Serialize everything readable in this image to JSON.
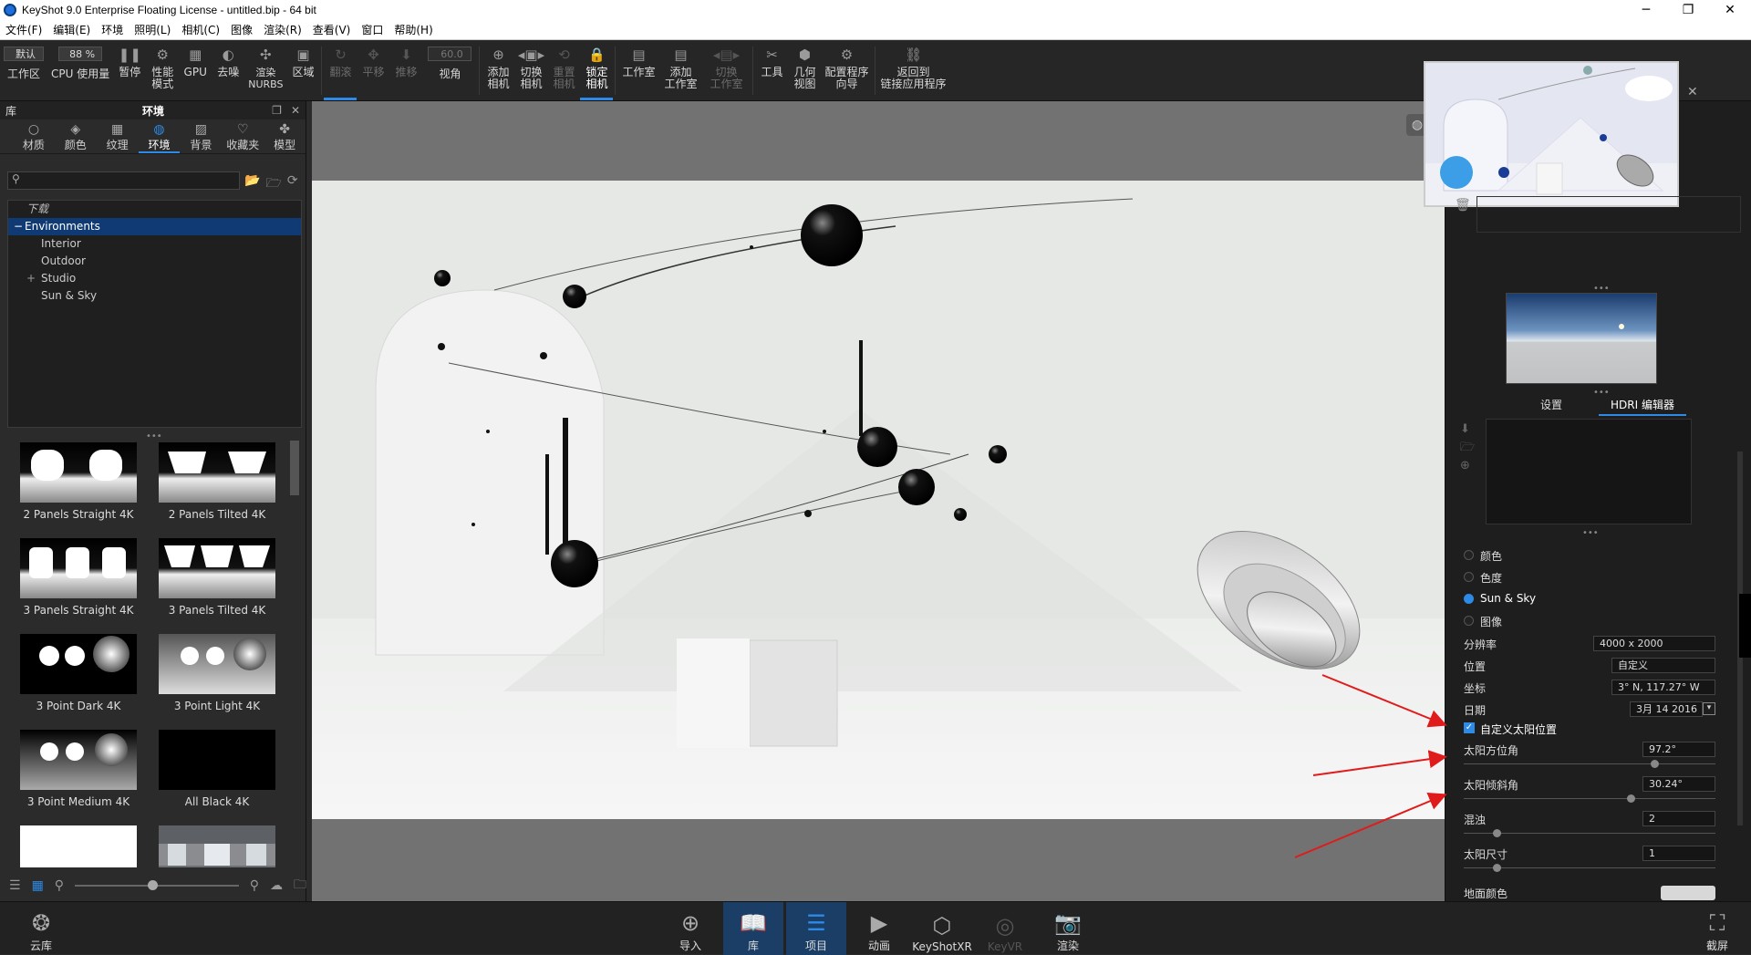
{
  "window": {
    "title": "KeyShot 9.0 Enterprise Floating License  - untitled.bip  - 64 bit",
    "minimize": "─",
    "restore": "❐",
    "close": "✕"
  },
  "menu": [
    "文件(F)",
    "编辑(E)",
    "环境",
    "照明(L)",
    "相机(C)",
    "图像",
    "渲染(R)",
    "查看(V)",
    "窗口",
    "帮助(H)"
  ],
  "toolbar": {
    "preset_value": "默认",
    "zoom_value": "88 %",
    "fov_value": "60.0",
    "buttons": [
      {
        "label": "工作区",
        "state": "normal"
      },
      {
        "label": "CPU 使用量",
        "state": "normal"
      },
      {
        "label": "暂停",
        "state": "normal"
      },
      {
        "label": "性能\n模式",
        "state": "normal"
      },
      {
        "label": "GPU",
        "state": "normal"
      },
      {
        "label": "去噪",
        "state": "normal"
      },
      {
        "label": "渲染\nNURBS",
        "state": "normal"
      },
      {
        "label": "区域",
        "state": "normal"
      },
      {
        "label": "翻滚",
        "state": "active-dim"
      },
      {
        "label": "平移",
        "state": "dim"
      },
      {
        "label": "推移",
        "state": "dim"
      },
      {
        "label": "视角",
        "state": "normal"
      },
      {
        "label": "添加\n相机",
        "state": "normal"
      },
      {
        "label": "切换\n相机",
        "state": "normal"
      },
      {
        "label": "重置\n相机",
        "state": "dim"
      },
      {
        "label": "锁定\n相机",
        "state": "active"
      },
      {
        "label": "工作室",
        "state": "normal"
      },
      {
        "label": "添加\n工作室",
        "state": "normal"
      },
      {
        "label": "切换\n工作室",
        "state": "dim"
      },
      {
        "label": "工具",
        "state": "normal"
      },
      {
        "label": "几何\n视图",
        "state": "normal"
      },
      {
        "label": "配置程序\n向导",
        "state": "normal"
      },
      {
        "label": "返回到\n链接应用程序",
        "state": "normal"
      }
    ]
  },
  "library": {
    "header_left": "库",
    "header_title": "环境",
    "tabs": [
      "材质",
      "颜色",
      "纹理",
      "环境",
      "背景",
      "收藏夹",
      "模型"
    ],
    "active_tab": "环境",
    "tree": {
      "header": "下载",
      "items": [
        {
          "label": "Environments",
          "level": 1,
          "selected": true,
          "toggle": "−"
        },
        {
          "label": "Interior",
          "level": 2
        },
        {
          "label": "Outdoor",
          "level": 2
        },
        {
          "label": "Studio",
          "level": 2,
          "toggle": "+"
        },
        {
          "label": "Sun & Sky",
          "level": 2
        }
      ]
    },
    "thumbnails": [
      "2 Panels Straight 4K",
      "2 Panels Tilted 4K",
      "3 Panels Straight 4K",
      "3 Panels Tilted 4K",
      "3 Point Dark 4K",
      "3 Point Light 4K",
      "3 Point Medium 4K",
      "All Black 4K"
    ]
  },
  "right_panel": {
    "tabs": [
      "设置",
      "HDRI 编辑器"
    ],
    "active_tab": "HDRI 编辑器",
    "bg_options": [
      "颜色",
      "色度",
      "Sun & Sky",
      "图像"
    ],
    "selected_bg": "Sun & Sky",
    "resolution_label": "分辨率",
    "resolution_value": "4000 x 2000",
    "location_label": "位置",
    "location_value": "自定义",
    "coords_label": "坐标",
    "coords_value": "3° N, 117.27° W",
    "date_label": "日期",
    "date_value": "3月 14 2016",
    "custom_sun_label": "自定义太阳位置",
    "custom_sun_checked": true,
    "sun_azimuth_label": "太阳方位角",
    "sun_azimuth_value": "97.2°",
    "sun_elevation_label": "太阳倾斜角",
    "sun_elevation_value": "30.24°",
    "turbidity_label": "混浊",
    "turbidity_value": "2",
    "sun_size_label": "太阳尺寸",
    "sun_size_value": "1",
    "ground_label": "地面颜色"
  },
  "bottombar": {
    "cloud_label": "云库",
    "buttons": [
      {
        "label": "导入",
        "state": "normal"
      },
      {
        "label": "库",
        "state": "active"
      },
      {
        "label": "项目",
        "state": "active"
      },
      {
        "label": "动画",
        "state": "normal"
      },
      {
        "label": "KeyShotXR",
        "state": "normal"
      },
      {
        "label": "KeyVR",
        "state": "dim"
      },
      {
        "label": "渲染",
        "state": "normal"
      }
    ],
    "screenshot_label": "截屏"
  },
  "colors": {
    "accent": "#2d8ae6",
    "tree_selected": "#0f3a73",
    "annotation_arrow": "#e01b1b"
  }
}
